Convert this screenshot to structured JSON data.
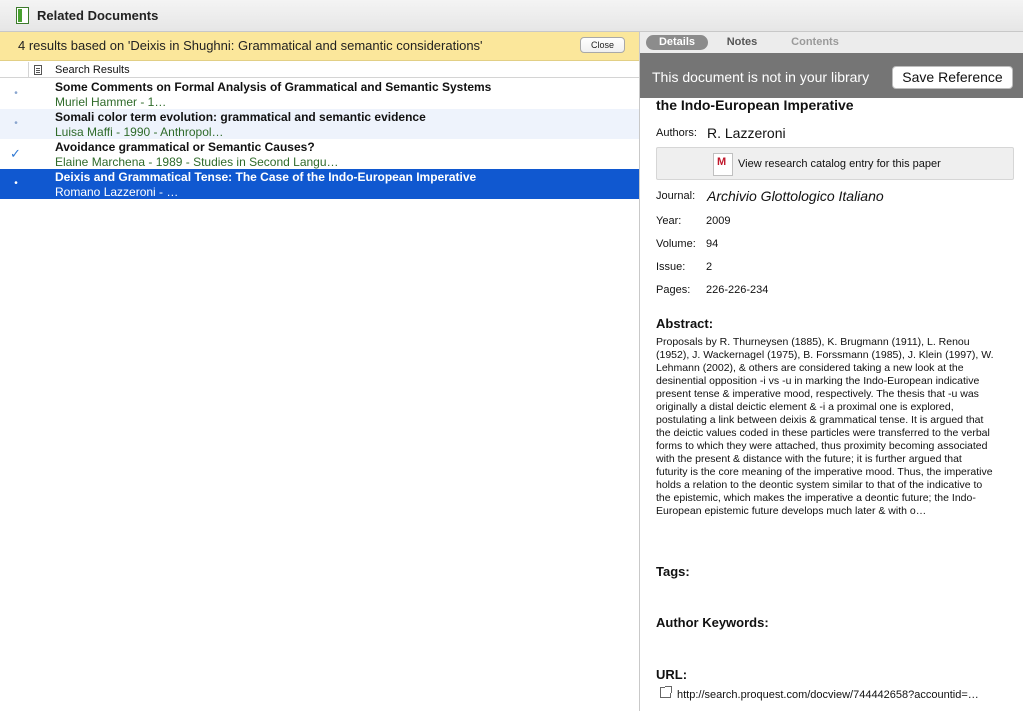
{
  "window": {
    "title": "Related Documents"
  },
  "banner": {
    "text": "4 results based on 'Deixis in Shughni: Grammatical and semantic considerations'",
    "close_label": "Close"
  },
  "list": {
    "column_header": "Search Results",
    "rows": [
      {
        "title": "Some Comments on Formal Analysis of Grammatical and Semantic Systems",
        "subtitle": "Muriel Hammer - 1…",
        "marker": "•",
        "state": "normal"
      },
      {
        "title": "Somali color term evolution: grammatical and semantic evidence",
        "subtitle": "Luisa Maffi - 1990 - Anthropol…",
        "marker": "•",
        "state": "alt"
      },
      {
        "title": "Avoidance grammatical or Semantic Causes?",
        "subtitle": "Elaine Marchena - 1989 - Studies in Second Langu…",
        "marker": "✓",
        "state": "normal"
      },
      {
        "title": "Deixis and Grammatical Tense: The Case of the Indo-European Imperative",
        "subtitle": "Romano Lazzeroni - …",
        "marker": "•",
        "state": "selected"
      }
    ]
  },
  "details": {
    "tabs": {
      "details": "Details",
      "notes": "Notes",
      "contents": "Contents"
    },
    "library_message": "This document is not in your library",
    "save_label": "Save Reference",
    "title_tail": "the Indo-European Imperative",
    "authors_label": "Authors:",
    "authors": "R. Lazzeroni",
    "catalog_label": "View research catalog entry for this paper",
    "journal_label": "Journal:",
    "journal": "Archivio Glottologico Italiano",
    "year_label": "Year:",
    "year": "2009",
    "volume_label": "Volume:",
    "volume": "94",
    "issue_label": "Issue:",
    "issue": "2",
    "pages_label": "Pages:",
    "pages": "226-226-234",
    "abstract_heading": "Abstract:",
    "abstract": "Proposals by R. Thurneysen (1885), K. Brugmann (1911), L. Renou (1952), J. Wackernagel (1975), B. Forssmann (1985), J. Klein (1997), W. Lehmann (2002), & others are considered taking a new look at the desinential opposition -i vs -u in marking the Indo-European indicative present tense & imperative mood, respectively. The thesis that -u was originally a distal deictic element & -i a proximal one is explored, postulating a link between deixis & grammatical tense. It is argued that the deictic values coded in these particles were transferred to the verbal forms to which they were attached, thus proximity becoming associated with the present & distance with the future; it is further argued that futurity is the core meaning of the imperative mood. Thus, the imperative holds a relation to the deontic system similar to that of the indicative to the epistemic, which makes the imperative a deontic future; the Indo-European epistemic future develops much later & with o…",
    "tags_heading": "Tags:",
    "keywords_heading": "Author Keywords:",
    "url_heading": "URL:",
    "url": "http://search.proquest.com/docview/744442658?accountid=…"
  }
}
